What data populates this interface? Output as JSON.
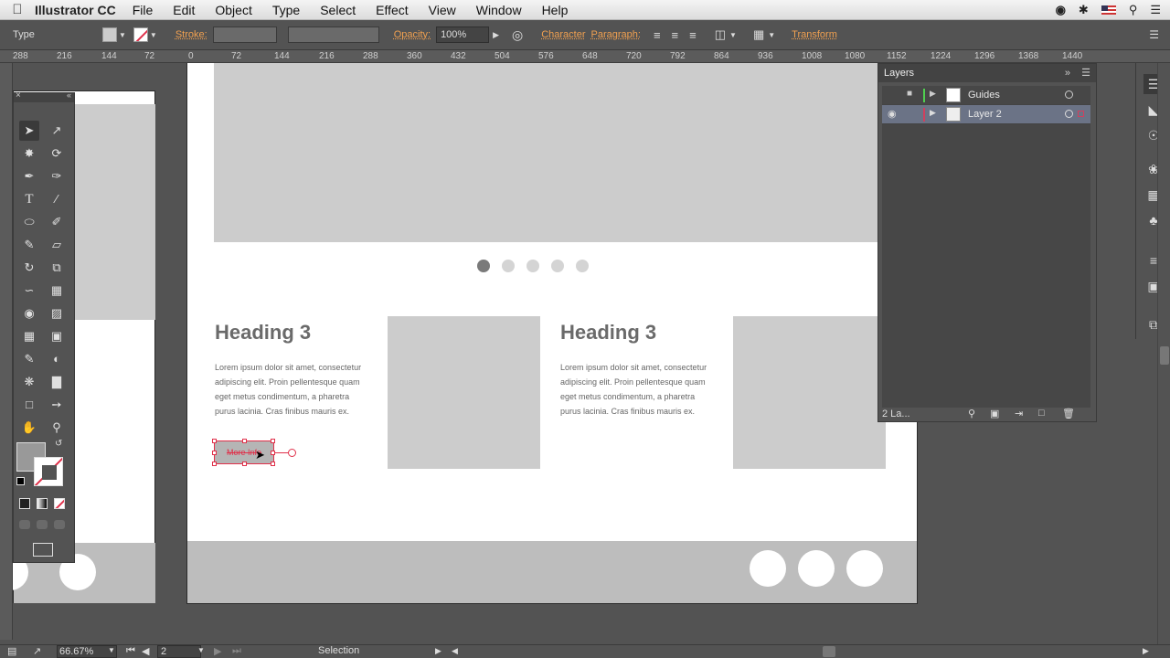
{
  "menubar": {
    "app_name": "Illustrator CC",
    "items": [
      "File",
      "Edit",
      "Object",
      "Type",
      "Select",
      "Effect",
      "View",
      "Window",
      "Help"
    ]
  },
  "control_bar": {
    "tool_name": "Type",
    "stroke_label": "Stroke:",
    "opacity_label": "Opacity:",
    "opacity_value": "100%",
    "character_label": "Character",
    "paragraph_label": "Paragraph:",
    "transform_label": "Transform"
  },
  "ruler_ticks": [
    "288",
    "216",
    "144",
    "72",
    "0",
    "72",
    "144",
    "216",
    "288",
    "360",
    "432",
    "504",
    "576",
    "648",
    "720",
    "792",
    "864",
    "936",
    "1008",
    "1080",
    "1152",
    "1224",
    "1296",
    "1368",
    "1440"
  ],
  "artboard": {
    "heading_left": "Heading 3",
    "heading_right": "Heading 3",
    "lorem_left": "Lorem ipsum dolor sit amet, consectetur adipiscing elit. Proin pellentesque quam eget metus condimentum, a pharetra purus lacinia. Cras finibus mauris ex.",
    "lorem_right": "Lorem ipsum dolor sit amet, consectetur adipiscing elit. Proin pellentesque quam eget metus condimentum, a pharetra purus lacinia. Cras finibus mauris ex.",
    "button_text": "More Info",
    "carousel_dots": 5,
    "active_dot": 1
  },
  "layers_panel": {
    "title": "Layers",
    "rows": [
      {
        "name": "Guides",
        "color": "#4fcf4f"
      },
      {
        "name": "Layer 2",
        "color": "#d0405e"
      }
    ],
    "footer_count": "2 La..."
  },
  "status_bar": {
    "zoom": "66.67%",
    "artboard_number": "2",
    "tool_status": "Selection"
  },
  "colors": {
    "ui_bg": "#535353",
    "accent_label": "#f0a050",
    "selection_red": "#e0304a",
    "layer_selected": "#6b7386"
  }
}
